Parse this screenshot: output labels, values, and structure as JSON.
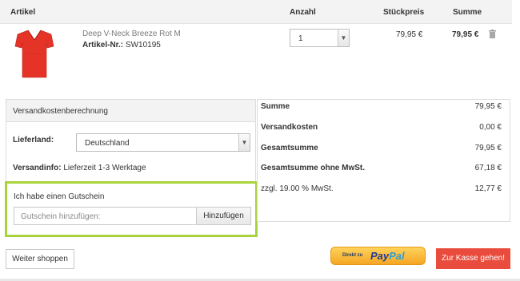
{
  "table_header": {
    "article": "Artikel",
    "quantity": "Anzahl",
    "unit_price": "Stückpreis",
    "sum": "Summe"
  },
  "product": {
    "name": "Deep V-Neck Breeze Rot M",
    "article_no_label": "Artikel-Nr.:",
    "article_no": "SW10195",
    "quantity": "1",
    "unit_price": "79,95 €",
    "sum": "79,95 €",
    "shirt_color": "#e53327"
  },
  "shipping": {
    "title": "Versandkostenberechnung",
    "country_label": "Lieferland:",
    "country_value": "Deutschland",
    "info_label": "Versandinfo:",
    "info_text": "Lieferzeit 1-3 Werktage"
  },
  "voucher": {
    "label": "Ich habe einen Gutschein",
    "placeholder": "Gutschein hinzufügen:",
    "button": "Hinzufügen",
    "highlight_color": "#a8d43b"
  },
  "summary": {
    "rows": [
      {
        "label": "Summe",
        "value": "79,95 €"
      },
      {
        "label": "Versandkosten",
        "value": "0,00 €"
      },
      {
        "label": "Gesamtsumme",
        "value": "79,95 €"
      },
      {
        "label": "Gesamtsumme ohne MwSt.",
        "value": "67,18 €"
      },
      {
        "label": "zzgl. 19.00 % MwSt.",
        "value": "12,77 €"
      }
    ]
  },
  "footer": {
    "continue_shopping": "Weiter shoppen",
    "paypal_prefix": "Direkt zu",
    "paypal_pay": "Pay",
    "paypal_pal": "Pal",
    "checkout": "Zur Kasse gehen!",
    "checkout_color": "#e94b3c"
  }
}
